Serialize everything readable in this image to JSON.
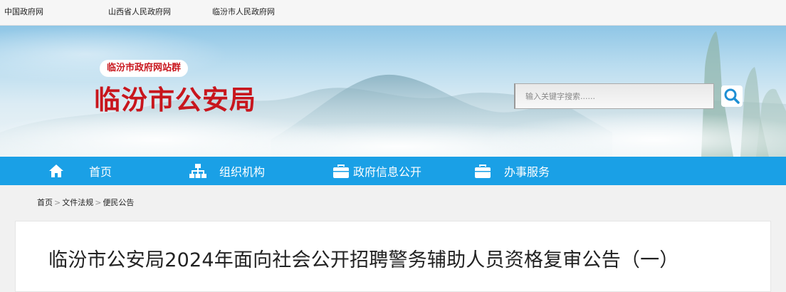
{
  "topbar": {
    "links": [
      "中国政府网",
      "山西省人民政府网",
      "临汾市人民政府网"
    ]
  },
  "header": {
    "site_group": "临汾市政府网站群",
    "title": "临汾市公安局",
    "search": {
      "placeholder": "输入关键字搜索......",
      "button_icon": "search-icon"
    }
  },
  "nav": {
    "items": [
      {
        "label": "首页",
        "icon": "home-icon"
      },
      {
        "label": "组织机构",
        "icon": "org-chart-icon"
      },
      {
        "label": "政府信息公开",
        "icon": "briefcase-icon"
      },
      {
        "label": "办事服务",
        "icon": "briefcase-icon"
      }
    ]
  },
  "breadcrumb": {
    "items": [
      "首页",
      "文件法规",
      "便民公告"
    ],
    "separator": ">"
  },
  "article": {
    "title": "临汾市公安局2024年面向社会公开招聘警务辅助人员资格复审公告（一）"
  },
  "colors": {
    "brand_red": "#c8161d",
    "nav_blue": "#1aa0e6"
  }
}
